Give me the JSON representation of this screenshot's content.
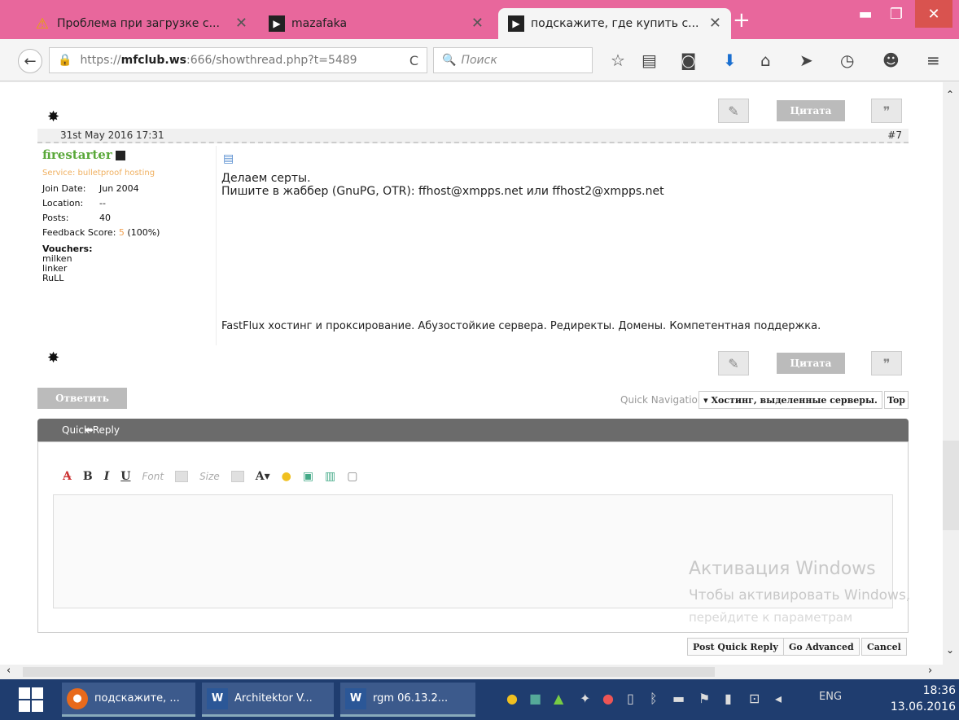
{
  "browser": {
    "tabs": [
      {
        "title": "Проблема при загрузке с...",
        "icon": "warning-icon"
      },
      {
        "title": "mazafaka",
        "icon": "site-icon"
      },
      {
        "title": "подскажите, где купить с...",
        "icon": "site-icon"
      }
    ],
    "new_tab": "+",
    "url_prefix": "https://",
    "url_host": "mfclub.ws",
    "url_rest": ":666/showthread.php?t=5489",
    "search_placeholder": "Поиск"
  },
  "post": {
    "date": "31st May 2016 17:31",
    "number": "#7",
    "quote_label": "Цитата",
    "user": {
      "name": "firestarter",
      "title": "Service: bulletproof hosting",
      "join_date_label": "Join Date:",
      "join_date": "Jun 2004",
      "location_label": "Location:",
      "location": "--",
      "posts_label": "Posts:",
      "posts": "40",
      "feedback_label": "Feedback Score:",
      "feedback_value": "5",
      "feedback_pct": "(100%)",
      "vouchers_label": "Vouchers:",
      "vouchers": [
        "milken",
        "linker",
        "RuLL"
      ]
    },
    "message_line1": "Делаем серты.",
    "message_line2": "Пишите в жаббер (GnuPG, OTR): ffhost@xmpps.net или ffhost2@xmpps.net",
    "signature": "FastFlux хостинг и проксирование. Абузостойкие сервера. Редиректы. Домены. Компетентная поддержка."
  },
  "nav": {
    "reply_label": "Ответить",
    "quick_nav_label": "Quick Navigation",
    "quick_nav_value": "▾ Хостинг, выделенные серверы.",
    "top_label": "Top"
  },
  "quick_reply": {
    "header": "Quick Reply",
    "font_placeholder": "Font",
    "size_placeholder": "Size",
    "post_label": "Post Quick Reply",
    "advanced_label": "Go Advanced",
    "cancel_label": "Cancel"
  },
  "watermark": {
    "line1": "Активация Windows",
    "line2": "Чтобы активировать Windows,",
    "line3": "перейдите к параметрам"
  },
  "taskbar": {
    "apps": [
      {
        "label": "подскажите, ..."
      },
      {
        "label": "Architektor V..."
      },
      {
        "label": "rgm 06.13.2..."
      }
    ],
    "lang": "ENG",
    "time": "18:36",
    "date": "13.06.2016"
  }
}
